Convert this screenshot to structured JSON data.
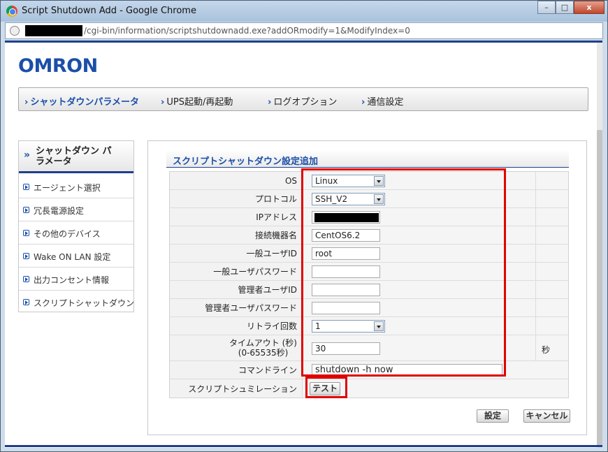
{
  "window": {
    "title": "Script Shutdown Add - Google Chrome",
    "minimize": "–",
    "maximize": "□",
    "close": "x"
  },
  "address": {
    "url": "/cgi-bin/information/scriptshutdownadd.exe?addORmodify=1&ModifyIndex=0"
  },
  "brand": {
    "logo": "OMRON",
    "color": "#1b4fa8"
  },
  "topnav": [
    {
      "label": "シャットダウンパラメータ",
      "active": true
    },
    {
      "label": "UPS起動/再起動"
    },
    {
      "label": "ログオプション"
    },
    {
      "label": "通信設定"
    }
  ],
  "sidebar": {
    "header": "シャットダウン パラメータ",
    "items": [
      {
        "label": "エージェント選択"
      },
      {
        "label": "冗長電源設定"
      },
      {
        "label": "その他のデバイス"
      },
      {
        "label": "Wake ON LAN 設定"
      },
      {
        "label": "出力コンセント情報"
      },
      {
        "label": "スクリプトシャットダウン"
      }
    ]
  },
  "panel": {
    "title": "スクリプトシャットダウン設定追加",
    "fields": {
      "os": {
        "label": "OS",
        "value": "Linux"
      },
      "protocol": {
        "label": "プロトコル",
        "value": "SSH_V2"
      },
      "ip": {
        "label": "IPアドレス"
      },
      "device": {
        "label": "接続機器名",
        "value": "CentOS6.2"
      },
      "user": {
        "label": "一般ユーザID",
        "value": "root"
      },
      "user_pw": {
        "label": "一般ユーザパスワード",
        "value": ""
      },
      "admin": {
        "label": "管理者ユーザID",
        "value": ""
      },
      "admin_pw": {
        "label": "管理者ユーザパスワード",
        "value": ""
      },
      "retry": {
        "label": "リトライ回数",
        "value": "1"
      },
      "timeout": {
        "label_line1": "タイムアウト (秒)",
        "label_line2": "(0-65535秒)",
        "value": "30",
        "unit": "秒"
      },
      "command": {
        "label": "コマンドライン",
        "value": "shutdown -h now"
      },
      "simulation": {
        "label": "スクリプトシュミレーション",
        "button": "テスト"
      }
    },
    "buttons": {
      "ok": "設定",
      "cancel": "キャンセル"
    }
  }
}
